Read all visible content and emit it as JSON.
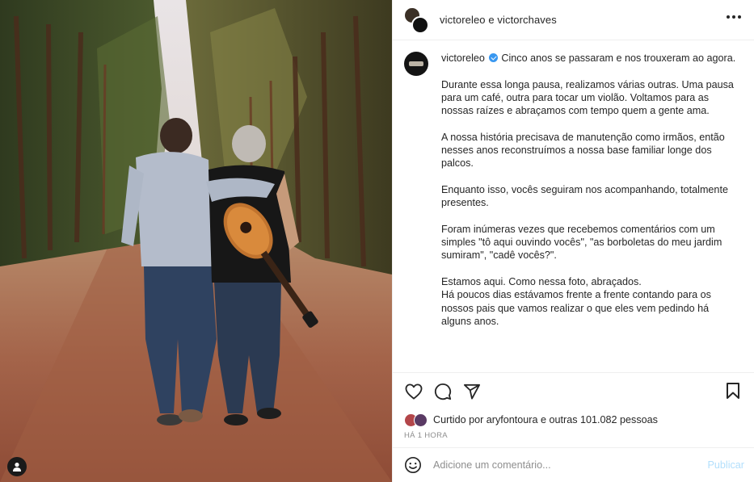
{
  "header": {
    "title": "victoreleo e victorchaves",
    "more_icon": "more-horizontal-icon"
  },
  "caption": {
    "username": "victoreleo",
    "verified_icon": "verified-badge-icon",
    "first_line": "Cinco anos se passaram e nos trouxeram ao agora.",
    "p2": "Durante essa longa pausa, realizamos várias outras. Uma pausa para um café, outra para tocar um violão. Voltamos para as nossas raízes e abraçamos com tempo quem a gente ama.",
    "p3": "A nossa história precisava de manutenção como irmãos, então nesses anos reconstruímos a nossa base familiar longe dos palcos.",
    "p4": "Enquanto isso, vocês seguiram nos acompanhando, totalmente presentes.",
    "p5": "Foram inúmeras vezes que recebemos comentários com um simples \"tô aqui ouvindo vocês\", \"as borboletas do meu jardim sumiram\", \"cadê vocês?\".",
    "p6a": "Estamos aqui. Como nessa foto, abraçados.",
    "p6b": "Há poucos dias estávamos frente a frente contando para os nossos pais que vamos realizar o que eles vem pedindo há alguns anos."
  },
  "actions": {
    "icons": [
      "heart-icon",
      "comment-icon",
      "share-icon",
      "bookmark-icon"
    ]
  },
  "likes": {
    "text": "Curtido por aryfontoura e outras 101.082 pessoas"
  },
  "time": "HÁ 1 HORA",
  "comment": {
    "placeholder": "Adicione um comentário...",
    "publish_label": "Publicar",
    "emoji_icon": "emoji-icon"
  },
  "colors": {
    "accent": "#3897f0",
    "publish_disabled": "#b2dffc",
    "muted": "#8e8e8e",
    "border": "#efefef"
  }
}
